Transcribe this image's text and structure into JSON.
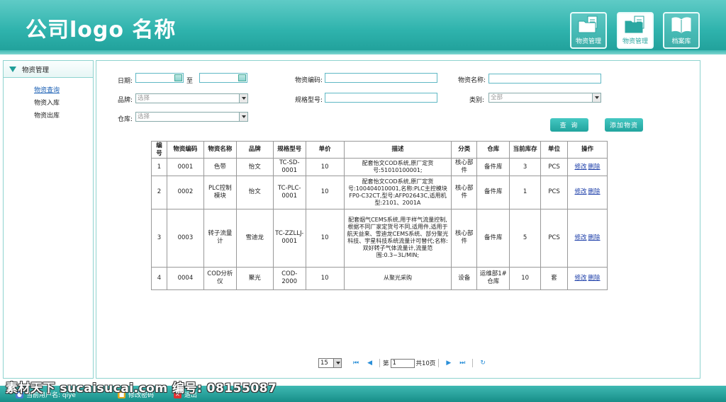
{
  "header": {
    "logo": "公司logo 名称",
    "buttons": [
      {
        "label": "物资管理",
        "icon": "folder-document-icon"
      },
      {
        "label": "物资管理",
        "icon": "folder-document-icon"
      },
      {
        "label": "档案库",
        "icon": "open-book-icon"
      }
    ]
  },
  "sidebar": {
    "title": "物资管理",
    "items": [
      {
        "label": "物资查询",
        "active": true
      },
      {
        "label": "物资入库",
        "active": false
      },
      {
        "label": "物资出库",
        "active": false
      }
    ]
  },
  "filters": {
    "date_label": "日期:",
    "to_label": "至",
    "code_label": "物资编码:",
    "name_label": "物资名称:",
    "brand_label": "品牌:",
    "brand_value": "选择",
    "spec_label": "规格型号:",
    "category_label": "类别:",
    "category_value": "全部",
    "warehouse_label": "仓库:",
    "warehouse_value": "选择",
    "query_button": "查 询",
    "add_button": "添加物资"
  },
  "table": {
    "headers": [
      "编号",
      "物资编码",
      "物资名称",
      "品牌",
      "规格型号",
      "单价",
      "描述",
      "分类",
      "仓库",
      "当前库存",
      "单位",
      "操作"
    ],
    "rows": [
      [
        "1",
        "0001",
        "色带",
        "怡文",
        "TC-SD-0001",
        "10",
        "配套怡文COD系统,原厂定货号:51010100001;",
        "核心部件",
        "备件库",
        "3",
        "PCS"
      ],
      [
        "2",
        "0002",
        "PLC控制模块",
        "怡文",
        "TC-PLC-0001",
        "10",
        "配套怡文COD系统,原厂定货号:100404010001,名称:PLC主控模块FP0-C32CT,型号:AFP02643C,适用机型:2101、2001A",
        "核心部件",
        "备件库",
        "1",
        "PCS"
      ],
      [
        "3",
        "0003",
        "转子流量计",
        "雪迪龙",
        "TC-ZZLLJ-0001",
        "10",
        "配套烟气CEMS系统,用于样气流量控制,根据不同厂家定货号不同,适用件,适用于航天益来、雪迪龙CEMS系统、部分聚光科技、宇星科技系统流量计可替代;名称:双好转子气体流量计,流量范围:0.3~3L/MIN;",
        "核心部件",
        "备件库",
        "5",
        "PCS"
      ],
      [
        "4",
        "0004",
        "COD分析仪",
        "聚光",
        "COD-2000",
        "10",
        "从聚光采购",
        "设备",
        "运维部1#仓库",
        "10",
        "套"
      ]
    ],
    "edit_label": "修改",
    "delete_label": "删除"
  },
  "pager": {
    "page_size": "15",
    "page_prefix": "第",
    "page_value": "1",
    "page_total": "共10页"
  },
  "footer": {
    "user": "当前用户名: qiye",
    "change_password": "修改密码",
    "logout": "退出"
  },
  "watermark": "素材天下 sucaisucai.com  编号: 08155087"
}
